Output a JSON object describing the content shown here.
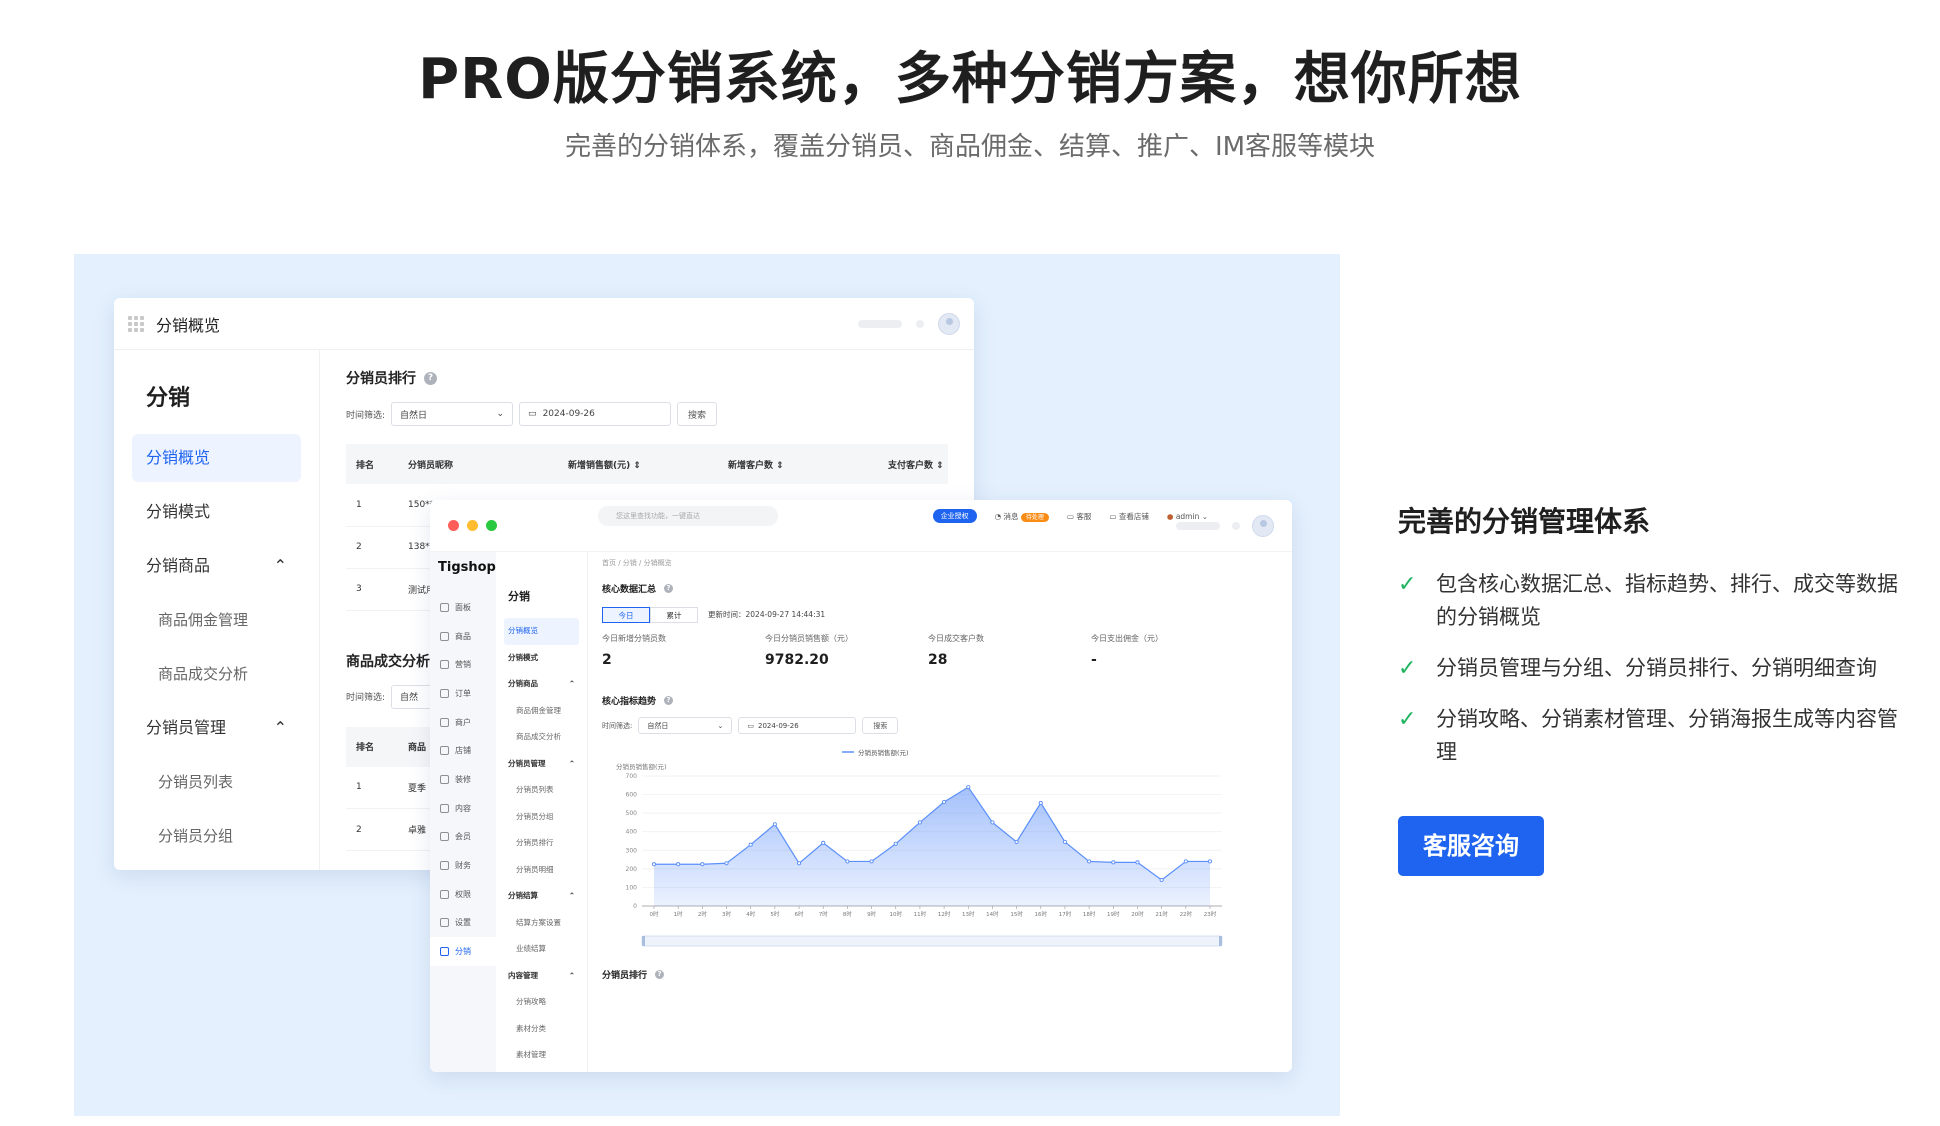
{
  "hero": {
    "title": "PRO版分销系统，多种分销方案，想你所想",
    "subtitle": "完善的分销体系，覆盖分销员、商品佣金、结算、推广、IM客服等模块"
  },
  "back_window": {
    "title": "分销概览",
    "sidebar_head": "分销",
    "nav": {
      "overview": "分销概览",
      "mode": "分销模式",
      "goods": "分销商品",
      "goods_commission": "商品佣金管理",
      "goods_deal": "商品成交分析",
      "member_mgmt": "分销员管理",
      "member_list": "分销员列表",
      "member_group": "分销员分组",
      "chevron_up": "⌃"
    },
    "rank": {
      "title": "分销员排行",
      "filter_label": "时间筛选:",
      "filter_value": "自然日",
      "date": "2024-09-26",
      "search_btn": "搜索",
      "columns": [
        "排名",
        "分销员昵称",
        "新增销售额(元)",
        "新增客户数",
        "支付客户数"
      ],
      "rows": [
        [
          "1",
          "150**"
        ],
        [
          "2",
          "138**"
        ],
        [
          "3",
          "测试用"
        ]
      ]
    },
    "deal": {
      "title": "商品成交分析",
      "filter_label": "时间筛选:",
      "filter_value": "自然",
      "columns": [
        "排名",
        "商品"
      ],
      "rows": [
        [
          "1",
          "夏季"
        ],
        [
          "2",
          "卓雅"
        ]
      ]
    }
  },
  "front_window": {
    "brand": "Tigshop",
    "search_placeholder": "您这里查找功能，一键直达",
    "top": {
      "member_badge": "企业授权",
      "messages": "消息",
      "msg_badge": "待处理",
      "service": "客服",
      "service_count": "2",
      "shop": "查看店铺",
      "user": "admin"
    },
    "icon_nav": [
      "面板",
      "商品",
      "营销",
      "订单",
      "商户",
      "店铺",
      "装修",
      "内容",
      "会员",
      "财务",
      "权限",
      "设置",
      "分销"
    ],
    "menu": {
      "head": "分销",
      "items": [
        {
          "label": "分销概览",
          "kind": "act"
        },
        {
          "label": "分销模式",
          "kind": "grp"
        },
        {
          "label": "分销商品",
          "kind": "grp"
        },
        {
          "label": "商品佣金管理",
          "kind": "s"
        },
        {
          "label": "商品成交分析",
          "kind": "s"
        },
        {
          "label": "分销员管理",
          "kind": "grp"
        },
        {
          "label": "分销员列表",
          "kind": "s"
        },
        {
          "label": "分销员分组",
          "kind": "s"
        },
        {
          "label": "分销员排行",
          "kind": "s"
        },
        {
          "label": "分销员明细",
          "kind": "s"
        },
        {
          "label": "分销结算",
          "kind": "grp"
        },
        {
          "label": "结算方案设置",
          "kind": "s"
        },
        {
          "label": "业绩结算",
          "kind": "s"
        },
        {
          "label": "内容管理",
          "kind": "grp"
        },
        {
          "label": "分销攻略",
          "kind": "s"
        },
        {
          "label": "素材分类",
          "kind": "s"
        },
        {
          "label": "素材管理",
          "kind": "s"
        }
      ]
    },
    "breadcrumb": "首页 / 分销 / 分销概览",
    "core": {
      "title": "核心数据汇总",
      "tab_today": "今日",
      "tab_total": "累计",
      "updated": "更新时间：2024-09-27 14:44:31",
      "kpis": [
        {
          "label": "今日新增分销员数",
          "value": "2"
        },
        {
          "label": "今日分销员销售额（元）",
          "value": "9782.20"
        },
        {
          "label": "今日成交客户数",
          "value": "28"
        },
        {
          "label": "今日支出佣金（元）",
          "value": "-"
        }
      ]
    },
    "trend": {
      "title": "核心指标趋势",
      "filter_label": "时间筛选:",
      "filter_value": "自然日",
      "date": "2024-09-26",
      "search_btn": "搜索"
    },
    "bottom_title": "分销员排行"
  },
  "chart_data": {
    "type": "area",
    "legend": "分销员销售额(元)",
    "ylabel": "分销员销售额(元)",
    "ylim": [
      0,
      700
    ],
    "yticks": [
      0,
      100,
      200,
      300,
      400,
      500,
      600,
      700
    ],
    "x": [
      "0时",
      "1时",
      "2时",
      "3时",
      "4时",
      "5时",
      "6时",
      "7时",
      "8时",
      "9时",
      "10时",
      "11时",
      "12时",
      "13时",
      "14时",
      "15时",
      "16时",
      "17时",
      "18时",
      "19时",
      "20时",
      "21时",
      "22时",
      "23时"
    ],
    "values": [
      225,
      225,
      225,
      230,
      330,
      440,
      230,
      340,
      240,
      240,
      335,
      450,
      560,
      640,
      450,
      345,
      555,
      345,
      240,
      235,
      235,
      140,
      240,
      240
    ],
    "grid": true,
    "color": "#5b8ff9"
  },
  "right": {
    "title": "完善的分销管理体系",
    "features": [
      "包含核心数据汇总、指标趋势、排行、成交等数据的分销概览",
      "分销员管理与分组、分销员排行、分销明细查询",
      "分销攻略、分销素材管理、分销海报生成等内容管理"
    ],
    "check": "✓",
    "cta": "客服咨询"
  }
}
